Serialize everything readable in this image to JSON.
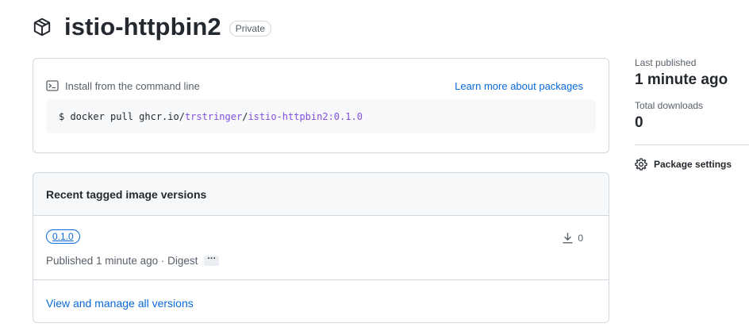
{
  "header": {
    "title": "istio-httpbin2",
    "visibility_badge": "Private",
    "icon": "package-icon"
  },
  "install": {
    "label": "Install from the command line",
    "learn_more": "Learn more about packages",
    "command_prefix": "$ docker pull ghcr.io/",
    "command_owner": "trstringer",
    "command_sep": "/",
    "command_image": "istio-httpbin2:0.1.0",
    "icon": "terminal-icon"
  },
  "versions": {
    "heading": "Recent tagged image versions",
    "items": [
      {
        "tag": "0.1.0",
        "published": "Published 1 minute ago · Digest",
        "digest_toggle": "···",
        "downloads": "0"
      }
    ],
    "view_all": "View and manage all versions"
  },
  "sidebar": {
    "last_published_label": "Last published",
    "last_published_value": "1 minute ago",
    "total_downloads_label": "Total downloads",
    "total_downloads_value": "0",
    "settings_label": "Package settings"
  },
  "colors": {
    "link": "#0969da",
    "muted": "#57606a",
    "border": "#d0d7de",
    "code_path": "#8250df"
  }
}
